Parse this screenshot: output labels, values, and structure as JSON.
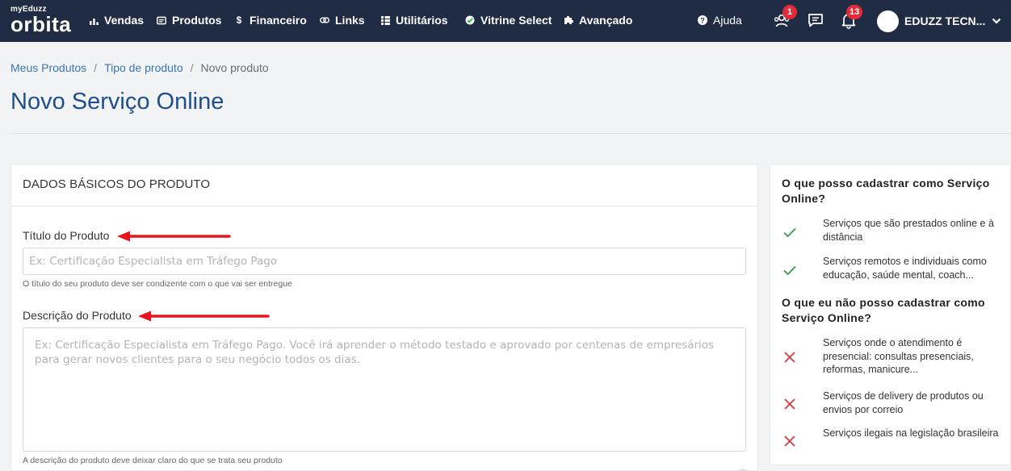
{
  "navbar": {
    "logo_small": "myEduzz",
    "logo_big": "orbita",
    "items": [
      {
        "label": "Vendas",
        "icon": "bar-chart-icon"
      },
      {
        "label": "Produtos",
        "icon": "product-card-icon"
      },
      {
        "label": "Financeiro",
        "icon": "dollar-icon"
      },
      {
        "label": "Links",
        "icon": "link-icon"
      },
      {
        "label": "Utilitários",
        "icon": "grid-list-icon"
      },
      {
        "label": "Vitrine Select",
        "icon": "check-badge-icon"
      },
      {
        "label": "Avançado",
        "icon": "puzzle-icon"
      }
    ],
    "help_label": "Ajuda",
    "affiliates_badge": "1",
    "notifications_badge": "13",
    "user_name": "EDUZZ TECN..."
  },
  "breadcrumb": {
    "items": [
      "Meus Produtos",
      "Tipo de produto"
    ],
    "current": "Novo produto"
  },
  "page": {
    "title": "Novo Serviço Online"
  },
  "form": {
    "section_title": "DADOS BÁSICOS DO PRODUTO",
    "title_label": "Título do Produto",
    "title_placeholder": "Ex: Certificação Especialista em Tráfego Pago",
    "title_help": "O título do seu produto deve ser condizente com o que vai ser entregue",
    "description_label": "Descrição do Produto",
    "description_placeholder": "Ex: Certificação Especialista em Tráfego Pago. Você irá aprender o método testado e aprovado por centenas de empresários para gerar novos clientes para o seu negócio todos os dias.",
    "description_help": "A descrição do produto deve deixar claro do que se trata seu produto"
  },
  "sidebar": {
    "can_title": "O que posso cadastrar como Serviço Online?",
    "can_items": [
      "Serviços que são prestados online e à distância",
      "Serviços remotos e individuais como educação, saúde mental, coach..."
    ],
    "cannot_title": "O que eu não posso cadastrar como Serviço Online?",
    "cannot_items": [
      "Serviços onde o atendimento é presencial: consultas presenciais, reformas, manicure...",
      "Serviços de delivery de produtos ou envios por correio",
      "Serviços ilegais na legislação brasileira"
    ]
  },
  "colors": {
    "navbar_bg": "#1f2c44",
    "title_blue": "#1f4e8c",
    "link_blue": "#3a76b4",
    "badge_red": "#e02b39",
    "annotation_arrow_red": "#e8141e",
    "check_green": "#2f9e44",
    "cross_red": "#d9363e"
  }
}
